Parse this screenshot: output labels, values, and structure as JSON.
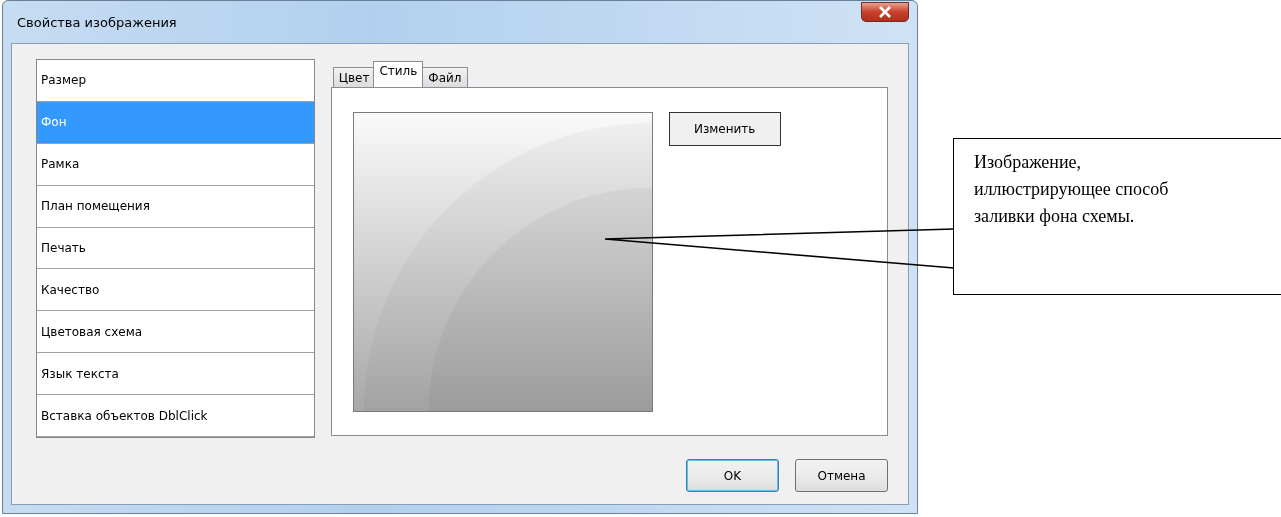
{
  "window": {
    "title": "Свойства изображения"
  },
  "sidebar": {
    "items": [
      {
        "label": "Размер",
        "selected": false
      },
      {
        "label": "Фон",
        "selected": true
      },
      {
        "label": "Рамка",
        "selected": false
      },
      {
        "label": "План помещения",
        "selected": false
      },
      {
        "label": "Печать",
        "selected": false
      },
      {
        "label": "Качество",
        "selected": false
      },
      {
        "label": "Цветовая схема",
        "selected": false
      },
      {
        "label": "Язык текста",
        "selected": false
      },
      {
        "label": "Вставка объектов DblClick",
        "selected": false
      }
    ]
  },
  "tabs": [
    {
      "label": "Цвет",
      "selected": false
    },
    {
      "label": "Стиль",
      "selected": true
    },
    {
      "label": "Файл",
      "selected": false
    }
  ],
  "change_button": {
    "label": "Изменить"
  },
  "buttons": [
    {
      "label": "OK",
      "default": true
    },
    {
      "label": "Отмена",
      "default": false
    }
  ],
  "callout": {
    "text": "Изображение, иллюстрирующее способ заливки фона схемы."
  }
}
